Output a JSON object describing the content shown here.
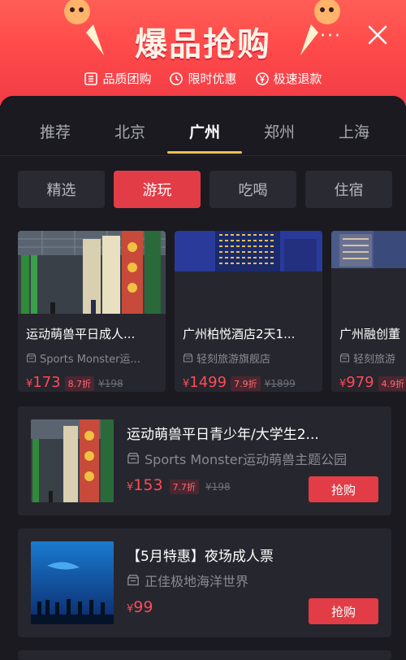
{
  "header": {
    "title": "爆品抢购",
    "more": "···",
    "features": [
      {
        "icon": "group-icon",
        "label": "品质团购"
      },
      {
        "icon": "clock-icon",
        "label": "限时优惠"
      },
      {
        "icon": "yen-icon",
        "label": "极速退款"
      }
    ]
  },
  "cities": [
    "推荐",
    "北京",
    "广州",
    "郑州",
    "上海"
  ],
  "active_city": "广州",
  "categories": [
    "精选",
    "游玩",
    "吃喝",
    "住宿"
  ],
  "active_category": "游玩",
  "featured": [
    {
      "name": "运动萌兽平日成人...",
      "shop": "Sports Monster运...",
      "price": "173",
      "discount": "8.7折",
      "original": "¥198"
    },
    {
      "name": "广州柏悦酒店2天1...",
      "shop": "轻刻旅游旗舰店",
      "price": "1499",
      "discount": "7.9折",
      "original": "¥1899"
    },
    {
      "name": "广州融创董",
      "shop": "轻刻旅游",
      "price": "979",
      "discount": "4.9折",
      "original": ""
    }
  ],
  "list": [
    {
      "name": "运动萌兽平日青少年/大学生2...",
      "shop": "Sports Monster运动萌兽主题公园",
      "price": "153",
      "discount": "7.7折",
      "original": "¥198",
      "button": "抢购"
    },
    {
      "name": "【5月特惠】夜场成人票",
      "shop": "正佳极地海洋世界",
      "price": "99",
      "discount": "",
      "original": "",
      "button": "抢购"
    }
  ],
  "currency": "¥",
  "colors": {
    "accent": "#e23c46",
    "header": "#ff4a4a",
    "underline": "#f2c04a",
    "price": "#ff4a55"
  }
}
